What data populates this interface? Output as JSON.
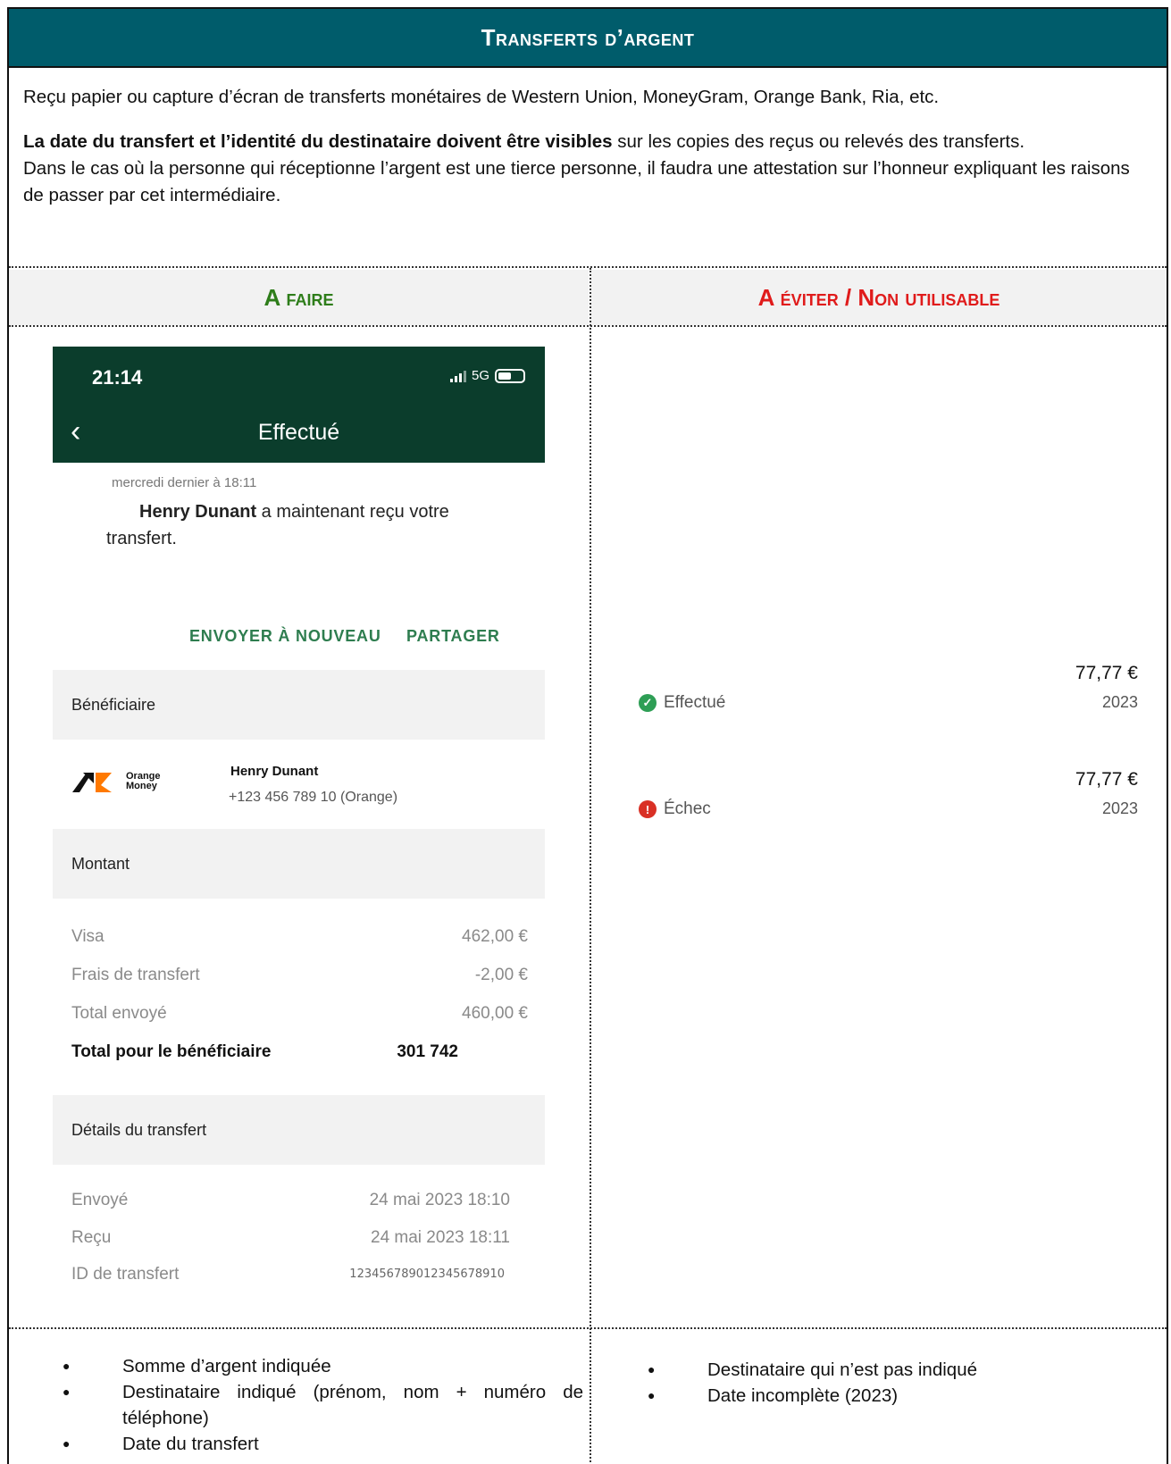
{
  "header": {
    "title": "Transferts d’argent"
  },
  "intro": {
    "line1": "Reçu papier ou capture d’écran de transferts monétaires de Western Union, MoneyGram, Orange Bank, Ria, etc.",
    "bold_part": "La date du transfert et l’identité du destinataire doivent être visibles",
    "rest_part": " sur les copies des reçus ou relevés des transferts.",
    "line3": "Dans le cas où la personne qui réceptionne l’argent est une tierce personne, il faudra une attestation sur l’honneur expliquant les raisons de passer par cet intermédiaire."
  },
  "columns": {
    "do_label": "A faire",
    "dont_label": "A éviter / Non utilisable"
  },
  "phone": {
    "time": "21:14",
    "network": "5G",
    "screen_title": "Effectué",
    "timestamp": "mercredi dernier à 18:11",
    "recipient_bold": "Henry Dunant",
    "message_rest": " a maintenant reçu votre transfert.",
    "action_resend": "ENVOYER À NOUVEAU",
    "action_share": "PARTAGER",
    "section_beneficiary": "Bénéficiaire",
    "logo_text_1": "Orange",
    "logo_text_2": "Money",
    "beneficiary_name": "Henry Dunant",
    "beneficiary_phone": "+123 456 789 10 (Orange)",
    "section_amount": "Montant",
    "rows": [
      {
        "label": "Visa",
        "value": "462,00 €"
      },
      {
        "label": "Frais de transfert",
        "value": "-2,00 €"
      },
      {
        "label": "Total envoyé",
        "value": "460,00 €"
      },
      {
        "label": "Total pour le bénéficiaire",
        "value": "301 742"
      }
    ],
    "section_details": "Détails du transfert",
    "details": [
      {
        "label": "Envoyé",
        "value": "24 mai 2023 18:10"
      },
      {
        "label": "Reçu",
        "value": "24 mai 2023 18:11"
      },
      {
        "label": "ID de transfert",
        "value": "12345678901234567891​0"
      }
    ]
  },
  "transactions": [
    {
      "amount": "77,77 €",
      "status": "Effectué",
      "year": "2023",
      "status_color": "#2e9e55"
    },
    {
      "amount": "77,77 €",
      "status": "Échec",
      "year": "2023",
      "status_color": "#d93025"
    }
  ],
  "do_bullets": [
    "Somme d’argent indiquée",
    "Destinataire indiqué (prénom, nom + numéro de téléphone)",
    "Date du transfert"
  ],
  "dont_bullets": [
    "Destinataire qui n’est pas indiqué",
    "Date incomplète (2023)"
  ]
}
